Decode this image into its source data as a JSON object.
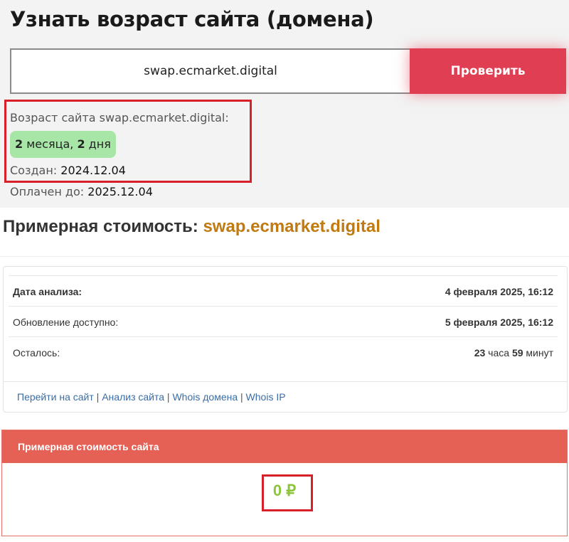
{
  "header": {
    "title": "Узнать возраст сайта (домена)"
  },
  "search": {
    "value": "swap.ecmarket.digital",
    "button_label": "Проверить"
  },
  "age": {
    "label": "Возраст сайта swap.ecmarket.digital:",
    "months_num": "2",
    "months_word": " месяца, ",
    "days_num": "2",
    "days_word": " дня",
    "created_label": "Создан: ",
    "created_value": "2024.12.04",
    "paid_label": "Оплачен до: ",
    "paid_value": "2025.12.04"
  },
  "estimate": {
    "title_prefix": "Примерная стоимость: ",
    "domain": "swap.ecmarket.digital"
  },
  "info": {
    "rows": [
      {
        "label": "Дата анализа:",
        "value": "4 февраля 2025, 16:12"
      },
      {
        "label": "Обновление доступно:",
        "value": "5 февраля 2025, 16:12"
      },
      {
        "label": "Осталось:",
        "hours": "23",
        "hours_word": " часа ",
        "minutes": "59",
        "minutes_word": " минут"
      }
    ],
    "links": [
      "Перейти на сайт",
      "Анализ сайта",
      "Whois домена",
      "Whois IP"
    ],
    "link_separator": " | "
  },
  "price": {
    "header": "Примерная стоимость сайта",
    "value": "0 ₽"
  },
  "colors": {
    "accent_red": "#e03e52",
    "badge_green": "#a8e6a8",
    "domain_orange": "#c17a10",
    "price_header": "#e56155",
    "price_green": "#8cc43c",
    "highlight_border": "#d8202b"
  }
}
